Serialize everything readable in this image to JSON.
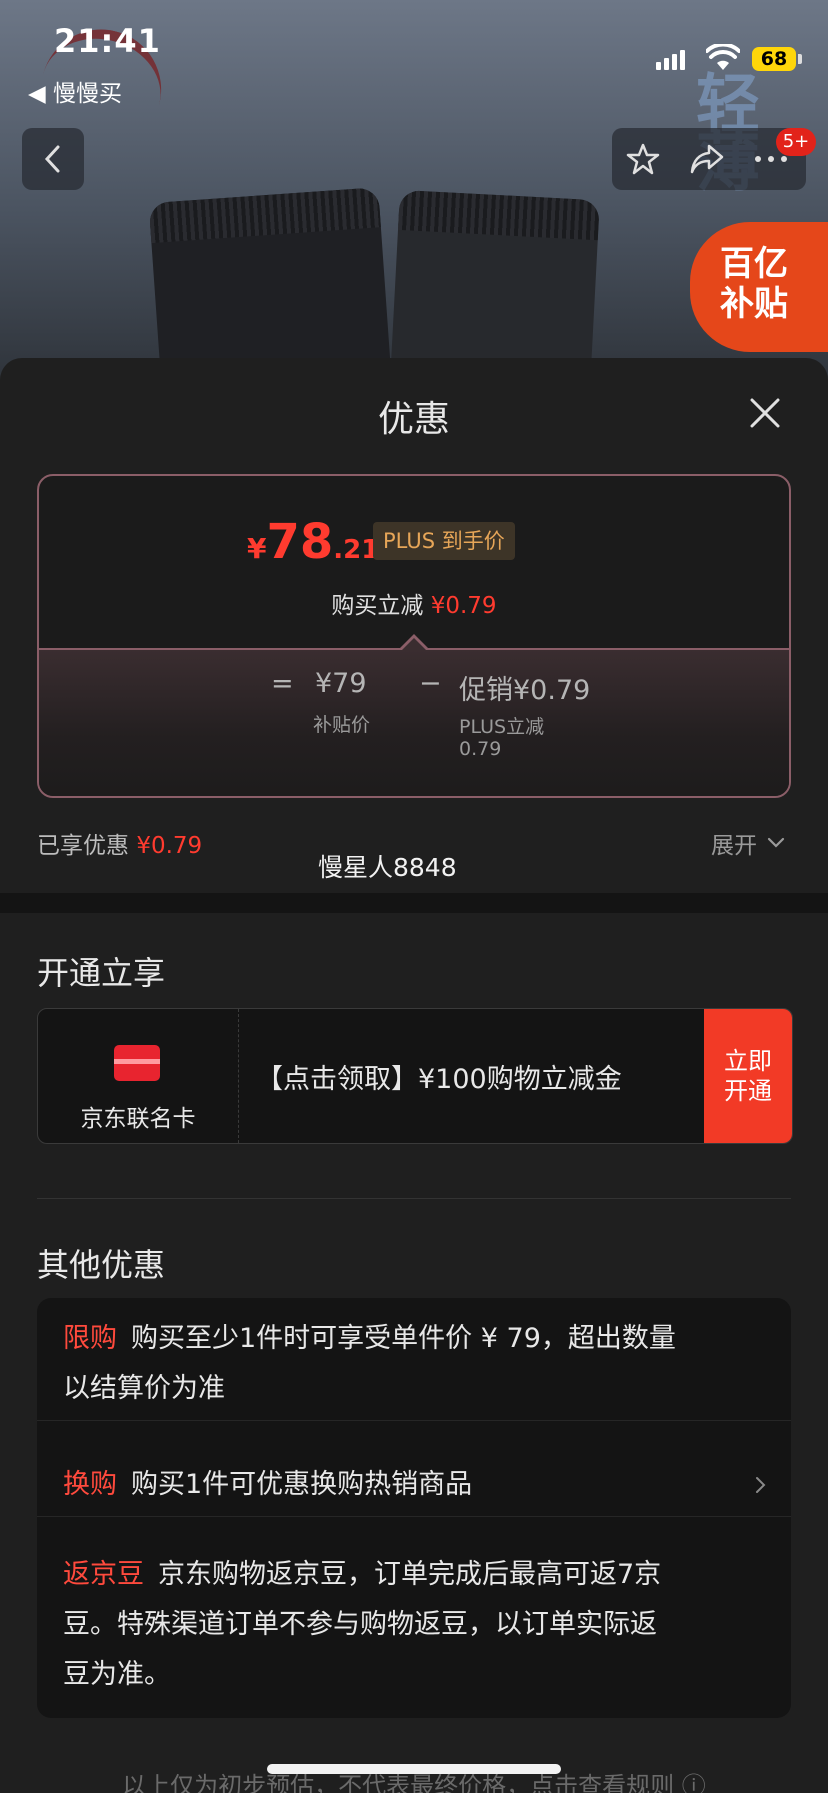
{
  "status_bar": {
    "time": "21:41",
    "back_app": "◀ 慢慢买",
    "battery": "68"
  },
  "header": {
    "notification_badge": "5+",
    "subsidy_badge_line1": "百亿",
    "subsidy_badge_line2": "补贴",
    "deco_text": "轻薄"
  },
  "sheet": {
    "title": "优惠"
  },
  "price_card": {
    "currency": "¥",
    "price_integer": "78",
    "price_decimal": ".21",
    "plus_tag": "PLUS 到手价",
    "instant_label": "购买立减",
    "instant_value": "¥0.79",
    "formula": {
      "equals": "=",
      "base_price": "¥79",
      "base_label": "补贴价",
      "minus": "−",
      "promo_label": "促销",
      "promo_value": "¥0.79",
      "promo_sub1": "PLUS立减",
      "promo_sub2": "0.79"
    }
  },
  "summary": {
    "enjoyed_label": "已享优惠",
    "enjoyed_value": "¥0.79",
    "expand_label": "展开",
    "nickname": "慢星人8848"
  },
  "open_section": {
    "title": "开通立享",
    "card_name": "京东联名卡",
    "offer": "【点击领取】¥100购物立减金",
    "button_line1": "立即",
    "button_line2": "开通"
  },
  "other_section": {
    "title": "其他优惠",
    "items": [
      {
        "tag": "限购",
        "text": "购买至少1件时可享受单件价 ¥ 79，超出数量",
        "text2": "以结算价为准"
      },
      {
        "tag": "换购",
        "text": "购买1件可优惠换购热销商品"
      },
      {
        "tag": "返京豆",
        "text": "京东购物返京豆，订单完成后最高可返7京",
        "text2": "豆。特殊渠道订单不参与购物返豆，以订单实际返",
        "text3": "豆为准。"
      }
    ]
  },
  "footer": {
    "text": "以上仅为初步预估，不代表最终价格，点击查看规则 ⓘ"
  },
  "colors": {
    "accent_red": "#ff3b2f",
    "plus_gold": "#e7a658",
    "button_red": "#f23a26"
  }
}
